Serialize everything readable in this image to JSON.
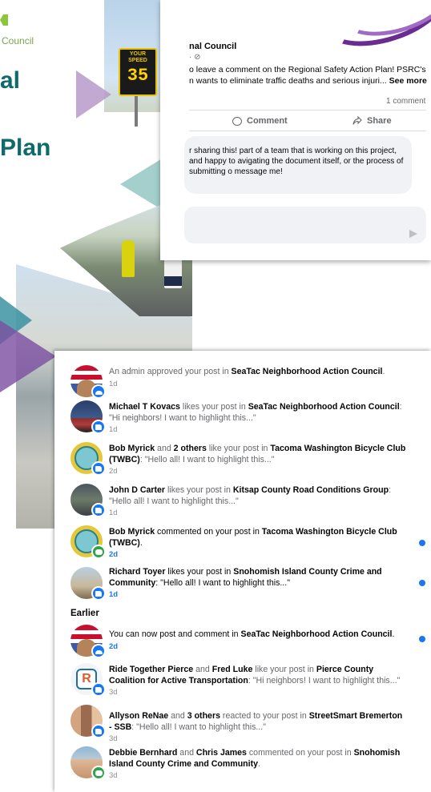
{
  "poster": {
    "brand_text": "Council",
    "headline_line1": "al",
    "headline_line2": "Plan",
    "speed_sign_label": "YOUR SPEED",
    "speed_sign_value": "35"
  },
  "post": {
    "author": "nal Council",
    "meta": "· ⊘",
    "text": "o leave a comment on the Regional Safety Action Plan! PSRC's n wants to eliminate traffic deaths and serious injuri...",
    "see_more": "See more",
    "comment_count": "1 comment",
    "comment_label": "Comment",
    "share_label": "Share",
    "reply_text": "r sharing this! part of a team that is working on this project, and happy to avigating the document itself, or the process of submitting o message me!"
  },
  "notifications": {
    "earlier_label": "Earlier",
    "items": [
      {
        "pre": "An admin approved your post in ",
        "b1": "SeaTac Neighborhood Action Council",
        "mid": ".",
        "b2": "",
        "post": "",
        "time": "1d",
        "unread": false
      },
      {
        "pre": "",
        "b1": "Michael T Kovacs",
        "mid": " likes your post in ",
        "b2": "SeaTac Neighborhood Action Council",
        "post": ": \"Hi neighbors! I want to highlight this...\"",
        "time": "1d",
        "unread": false
      },
      {
        "pre": "",
        "b1": "Bob Myrick",
        "mid": " and ",
        "b2": "2 others",
        "post": " like your post in ",
        "b3": "Tacoma Washington Bicycle Club (TWBC)",
        "post2": ": \"Hello all! I want to highlight this...\"",
        "time": "2d",
        "unread": false
      },
      {
        "pre": "",
        "b1": "John D Carter",
        "mid": " likes your post in ",
        "b2": "Kitsap County Road Conditions Group",
        "post": ": \"Hello all! I want to highlight this...\"",
        "time": "1d",
        "unread": false
      },
      {
        "pre": "",
        "b1": "Bob Myrick",
        "mid": " commented on your post in ",
        "b2": "Tacoma Washington Bicycle Club (TWBC)",
        "post": ".",
        "time": "2d",
        "unread": true
      },
      {
        "pre": "",
        "b1": "Richard Toyer",
        "mid": " likes your post in ",
        "b2": "Snohomish Island County Crime and Community",
        "post": ": \"Hello all! I want to highlight this...\"",
        "time": "1d",
        "unread": true
      },
      {
        "pre": "You can now post and comment in ",
        "b1": "SeaTac Neighborhood Action Council",
        "mid": ".",
        "b2": "",
        "post": "",
        "time": "2d",
        "unread": true
      },
      {
        "pre": "",
        "b1": "Ride Together Pierce",
        "mid": " and ",
        "b2": "Fred Luke",
        "post": " like your post in ",
        "b3": "Pierce County Coalition for Active Transportation",
        "post2": ": \"Hi neighbors! I want to highlight this...\"",
        "time": "3d",
        "unread": false
      },
      {
        "pre": "",
        "b1": "Allyson ReNae",
        "mid": " and ",
        "b2": "3 others",
        "post": " reacted to your post in ",
        "b3": "StreetSmart Bremerton - SSB",
        "post2": ": \"Hello all! I want to highlight this...\"",
        "time": "3d",
        "unread": false
      },
      {
        "pre": "",
        "b1": "Debbie Bernhard",
        "mid": " and ",
        "b2": "Chris James",
        "post": " commented on your post in ",
        "b3": "Snohomish Island County Crime and Community",
        "post2": ".",
        "time": "3d",
        "unread": false
      }
    ]
  },
  "colors": {
    "facebook_blue": "#1877f2",
    "comment_green": "#31a24c",
    "poster_teal": "#0f6b6b",
    "poster_purple": "#6a2c91"
  }
}
